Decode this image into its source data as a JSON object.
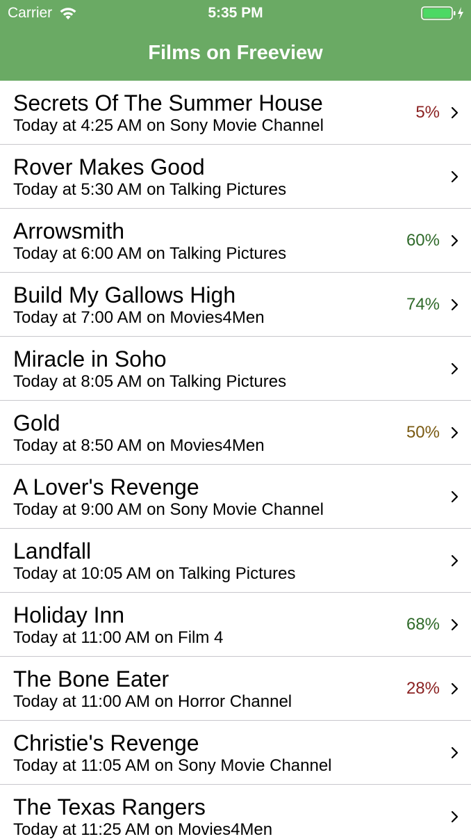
{
  "status_bar": {
    "carrier": "Carrier",
    "time": "5:35 PM",
    "icons": [
      "wifi-icon",
      "battery-icon",
      "charging-icon"
    ]
  },
  "nav": {
    "title": "Films on Freeview",
    "background_color": "#6aaa64"
  },
  "films": [
    {
      "title": "Secrets Of The Summer House",
      "subtitle": "Today at 4:25 AM on Sony Movie Channel",
      "score": "5%",
      "score_color": "red"
    },
    {
      "title": "Rover Makes Good",
      "subtitle": "Today at 5:30 AM on Talking Pictures",
      "score": "",
      "score_color": ""
    },
    {
      "title": "Arrowsmith",
      "subtitle": "Today at 6:00 AM on Talking Pictures",
      "score": "60%",
      "score_color": "green"
    },
    {
      "title": "Build My Gallows High",
      "subtitle": "Today at 7:00 AM on Movies4Men",
      "score": "74%",
      "score_color": "green"
    },
    {
      "title": "Miracle in Soho",
      "subtitle": "Today at 8:05 AM on Talking Pictures",
      "score": "",
      "score_color": ""
    },
    {
      "title": "Gold",
      "subtitle": "Today at 8:50 AM on Movies4Men",
      "score": "50%",
      "score_color": "olive"
    },
    {
      "title": "A Lover's Revenge",
      "subtitle": "Today at 9:00 AM on Sony Movie Channel",
      "score": "",
      "score_color": ""
    },
    {
      "title": "Landfall",
      "subtitle": "Today at 10:05 AM on Talking Pictures",
      "score": "",
      "score_color": ""
    },
    {
      "title": "Holiday Inn",
      "subtitle": "Today at 11:00 AM on Film 4",
      "score": "68%",
      "score_color": "green"
    },
    {
      "title": "The Bone Eater",
      "subtitle": "Today at 11:00 AM on Horror Channel",
      "score": "28%",
      "score_color": "red"
    },
    {
      "title": "Christie's Revenge",
      "subtitle": "Today at 11:05 AM on Sony Movie Channel",
      "score": "",
      "score_color": ""
    },
    {
      "title": "The Texas Rangers",
      "subtitle": "Today at 11:25 AM on Movies4Men",
      "score": "",
      "score_color": ""
    }
  ],
  "colors": {
    "score_red": "#8b2222",
    "score_green": "#2f6a2a",
    "score_olive": "#7a5a12",
    "separator": "#c8c7cc",
    "chevron": "#000000"
  },
  "row_icon": "chevron-right-icon"
}
